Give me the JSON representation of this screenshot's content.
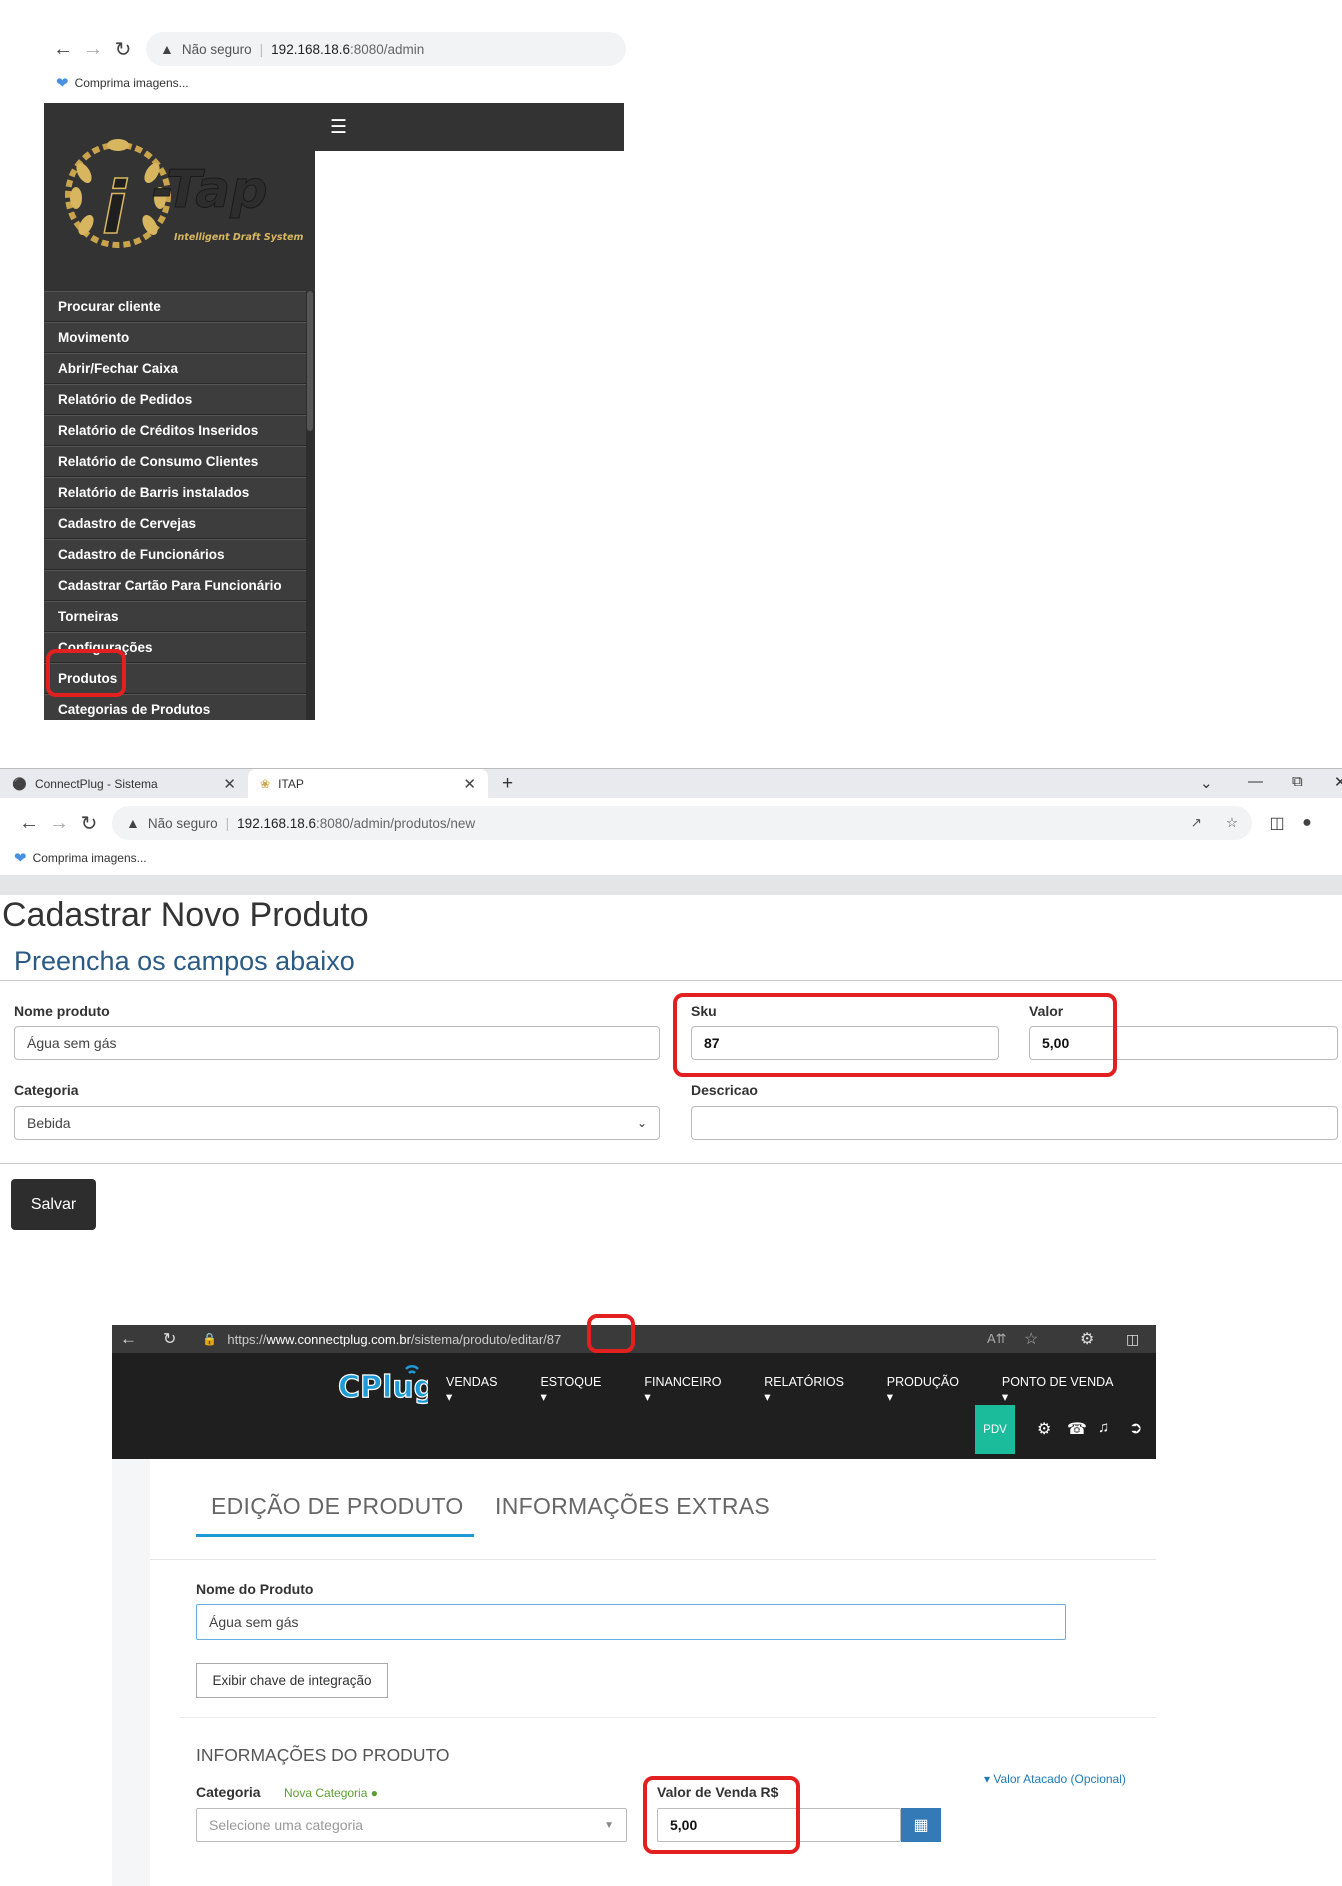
{
  "panel1": {
    "browser": {
      "insecure_label": "Não seguro",
      "url_host": "192.168.18.6",
      "url_path": ":8080/admin",
      "bookmark": "Comprima imagens..."
    },
    "logo": {
      "brand": "i-Tap",
      "tagline": "Intelligent Draft System"
    },
    "menu": [
      "Procurar cliente",
      "Movimento",
      "Abrir/Fechar Caixa",
      "Relatório de Pedidos",
      "Relatório de Créditos Inseridos",
      "Relatório de Consumo Clientes",
      "Relatório de Barris instalados",
      "Cadastro de Cervejas",
      "Cadastro de Funcionários",
      "Cadastrar Cartão Para Funcionário",
      "Torneiras",
      "Configurações",
      "Produtos",
      "Categorias de Produtos"
    ]
  },
  "panel2": {
    "tabs": [
      {
        "label": "ConnectPlug - Sistema"
      },
      {
        "label": "ITAP"
      }
    ],
    "browser": {
      "insecure_label": "Não seguro",
      "url_host": "192.168.18.6",
      "url_path": ":8080/admin/produtos/new",
      "bookmark": "Comprima imagens..."
    },
    "title": "Cadastrar Novo Produto",
    "subtitle": "Preencha os campos abaixo",
    "form": {
      "nome_label": "Nome produto",
      "nome_value": "Água sem gás",
      "sku_label": "Sku",
      "sku_value": "87",
      "valor_label": "Valor",
      "valor_value": "5,00",
      "categoria_label": "Categoria",
      "categoria_value": "Bebida",
      "descricao_label": "Descricao",
      "descricao_value": ""
    },
    "save_label": "Salvar"
  },
  "panel3": {
    "url": {
      "scheme": "https://",
      "host": "www.connectplug.com.br",
      "path_a": "/sistema/produto/edit",
      "path_b": "ar/87"
    },
    "logo": "CPlug",
    "menu": [
      "VENDAS",
      "ESTOQUE",
      "FINANCEIRO",
      "RELATÓRIOS",
      "PRODUÇÃO",
      "PONTO DE VENDA"
    ],
    "pdv": "PDV",
    "tabs": [
      "EDIÇÃO DE PRODUTO",
      "INFORMAÇÕES EXTRAS"
    ],
    "nome_label": "Nome do Produto",
    "nome_value": "Água sem gás",
    "chave_button": "Exibir chave de integração",
    "section_title": "INFORMAÇÕES DO PRODUTO",
    "valor_atacado": "Valor Atacado (Opcional)",
    "categoria_label": "Categoria",
    "nova_categoria": "Nova Categoria",
    "categoria_placeholder": "Selecione uma categoria",
    "valor_venda_label": "Valor de Venda R$",
    "valor_venda_value": "5,00",
    "accent": "#1e9bd7"
  }
}
